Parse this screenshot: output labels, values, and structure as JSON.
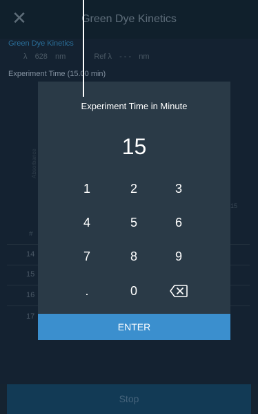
{
  "header": {
    "title": "Green Dye Kinetics"
  },
  "experiment": {
    "name": "Green Dye Kinetics",
    "lambda_label": "λ",
    "lambda_value": "628",
    "lambda_unit": "nm",
    "ref_label": "Ref λ",
    "ref_value": "- - -",
    "ref_unit": "nm",
    "time_label": "Experiment Time (15.00 min)"
  },
  "background": {
    "absorbance_label": "Absorbance",
    "hash": "#",
    "tick_15": "15",
    "rows": [
      "14",
      "15",
      "16",
      "17"
    ]
  },
  "dialog": {
    "title": "Experiment Time in Minute",
    "value": "15",
    "keys": [
      "1",
      "2",
      "3",
      "4",
      "5",
      "6",
      "7",
      "8",
      "9",
      ".",
      "0"
    ],
    "backspace_icon": "backspace-icon",
    "enter_label": "ENTER"
  },
  "footer": {
    "stop_label": "Stop"
  },
  "colors": {
    "accent": "#3b8fce",
    "dialog_bg": "#2a3a47",
    "page_bg": "#152330"
  }
}
